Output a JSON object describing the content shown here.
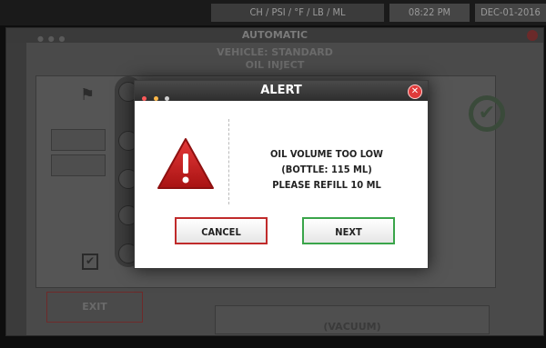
{
  "status_bar": {
    "units": "CH / PSI / °F / LB / ML",
    "time": "08:22 PM",
    "date": "DEC-01-2016"
  },
  "window": {
    "title": "AUTOMATIC",
    "vehicle_line1": "VEHICLE: STANDARD",
    "vehicle_line2": "OIL INJECT",
    "vacuum_label": "(VACUUM)",
    "exit_label": "EXIT"
  },
  "alert": {
    "title": "ALERT",
    "message_line1": "OIL VOLUME TOO LOW",
    "message_line2": "(BOTTLE: 115 ML)",
    "message_line3": "PLEASE REFILL 10 ML",
    "cancel_label": "CANCEL",
    "next_label": "NEXT"
  },
  "icons": {
    "warning": "warning-triangle-icon",
    "close": "close-icon",
    "flag": "checkered-flag-icon",
    "check": "check-circle-icon"
  },
  "colors": {
    "cancel_border": "#c02b2b",
    "next_border": "#3aa54a",
    "warning_red": "#c71d1d",
    "close_red": "#e03a3a"
  }
}
